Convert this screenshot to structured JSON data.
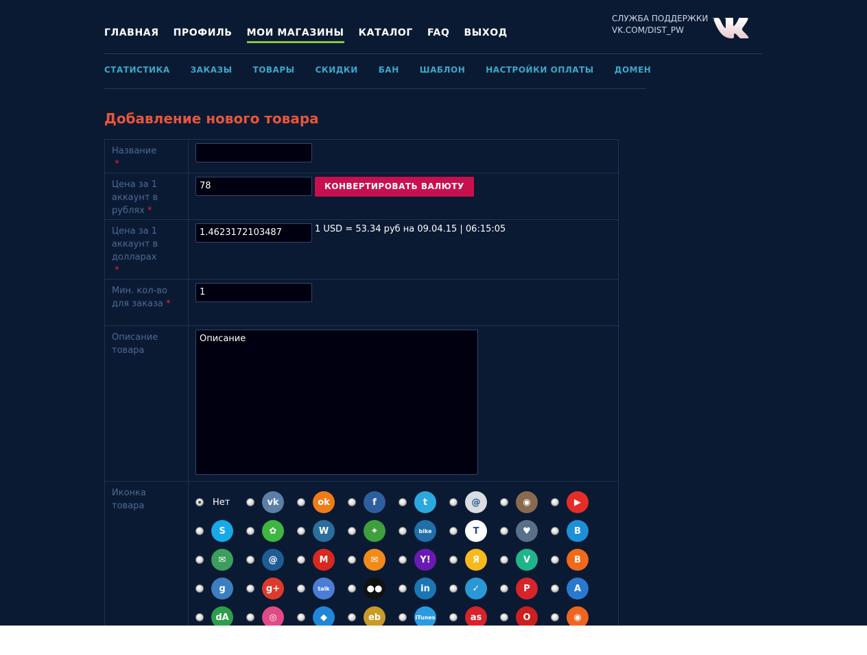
{
  "nav": {
    "items": [
      {
        "label": "ГЛАВНАЯ",
        "active": false
      },
      {
        "label": "ПРОФИЛЬ",
        "active": false
      },
      {
        "label": "МОИ МАГАЗИНЫ",
        "active": true
      },
      {
        "label": "КАТАЛОГ",
        "active": false
      },
      {
        "label": "FAQ",
        "active": false
      },
      {
        "label": "ВЫХОД",
        "active": false
      }
    ]
  },
  "support": {
    "line1": "СЛУЖБА ПОДДЕРЖКИ",
    "line2": "VK.COM/DIST_PW"
  },
  "subnav": {
    "items": [
      "СТАТИСТИКА",
      "ЗАКАЗЫ",
      "ТОВАРЫ",
      "СКИДКИ",
      "БАН",
      "ШАБЛОН",
      "НАСТРОЙКИ ОПЛАТЫ",
      "ДОМЕН"
    ]
  },
  "title": "Добавление нового товара",
  "form": {
    "name_label": "Название",
    "name_value": "",
    "price_rub_label": "Цена за 1 аккаунт в рублях",
    "price_rub_value": "78",
    "convert_button": "КОНВЕРТИРОВАТЬ ВАЛЮТУ",
    "price_usd_label": "Цена за 1 аккаунт в долларах",
    "price_usd_value": "1.4623172103487",
    "rate_text": "1 USD = 53.34 руб на 09.04.15 | 06:15:05",
    "min_qty_label": "Мин. кол-во для заказа",
    "min_qty_value": "1",
    "desc_label": "Описание товара",
    "desc_value": "Описание",
    "icon_label": "Иконка товара",
    "icon_none": "Нет",
    "required_mark": "*"
  },
  "icons": [
    {
      "name": "none",
      "checked": true
    },
    {
      "name": "vk-icon",
      "bg": "#5b7fa6",
      "glyph": "vk"
    },
    {
      "name": "odnoklassniki-icon",
      "bg": "#f07c16",
      "glyph": "ok"
    },
    {
      "name": "facebook-icon",
      "bg": "#2d5e9e",
      "glyph": "f"
    },
    {
      "name": "twitter-icon",
      "bg": "#2aa9e0",
      "glyph": "t"
    },
    {
      "name": "paperclip-icon",
      "bg": "#d9dde2",
      "glyph": "@"
    },
    {
      "name": "instagram-icon",
      "bg": "#8a6a4e",
      "glyph": "◉"
    },
    {
      "name": "youtube-icon",
      "bg": "#e52d27",
      "glyph": "▶"
    },
    {
      "name": "skype-icon",
      "bg": "#17a9e8",
      "glyph": "S"
    },
    {
      "name": "icq-icon",
      "bg": "#3fb63f",
      "glyph": "✿"
    },
    {
      "name": "warface-icon",
      "bg": "#2a6e9e",
      "glyph": "W"
    },
    {
      "name": "tanks-icon",
      "bg": "#3da03d",
      "glyph": "✦"
    },
    {
      "name": "bike-icon",
      "bg": "#1f6fa8",
      "glyph": "bike"
    },
    {
      "name": "turbo-icon",
      "bg": "#ffffff",
      "glyph": "T"
    },
    {
      "name": "heart-icon",
      "bg": "#5a6f88",
      "glyph": "♥"
    },
    {
      "name": "b-icon",
      "bg": "#1d8fd8",
      "glyph": "B"
    },
    {
      "name": "mail-icon",
      "bg": "#3c9e5c",
      "glyph": "✉"
    },
    {
      "name": "mailru-icon",
      "bg": "#1f5c94",
      "glyph": "@"
    },
    {
      "name": "gmail-icon",
      "bg": "#d8281f",
      "glyph": "M"
    },
    {
      "name": "email-icon",
      "bg": "#f28a1a",
      "glyph": "✉"
    },
    {
      "name": "yahoo-icon",
      "bg": "#6a1ab3",
      "glyph": "Y!"
    },
    {
      "name": "yandex-icon",
      "bg": "#f7b91c",
      "glyph": "Я"
    },
    {
      "name": "vine-icon",
      "bg": "#1fb58a",
      "glyph": "V"
    },
    {
      "name": "blogger-icon",
      "bg": "#f06a1a",
      "glyph": "B"
    },
    {
      "name": "google-icon",
      "bg": "#3c7ec0",
      "glyph": "g"
    },
    {
      "name": "google-plus-icon",
      "bg": "#dc3b2c",
      "glyph": "g+"
    },
    {
      "name": "talk-icon",
      "bg": "#4a7dd6",
      "glyph": "talk"
    },
    {
      "name": "myspace-icon",
      "bg": "#111111",
      "glyph": "●●"
    },
    {
      "name": "linkedin-icon",
      "bg": "#1b77b3",
      "glyph": "in"
    },
    {
      "name": "foursquare-icon",
      "bg": "#2a98d4",
      "glyph": "✓"
    },
    {
      "name": "pinterest-icon",
      "bg": "#d8232a",
      "glyph": "P"
    },
    {
      "name": "appstore-icon",
      "bg": "#2a79d0",
      "glyph": "A"
    },
    {
      "name": "deviantart-icon",
      "bg": "#2c9e4b",
      "glyph": "dA"
    },
    {
      "name": "dribbble-icon",
      "bg": "#e04a85",
      "glyph": "◎"
    },
    {
      "name": "dropbox-icon",
      "bg": "#1f86d8",
      "glyph": "◆"
    },
    {
      "name": "ebay-icon",
      "bg": "#c99a25",
      "glyph": "eb"
    },
    {
      "name": "itunes-icon",
      "bg": "#2a9be0",
      "glyph": "iTunes"
    },
    {
      "name": "lastfm-icon",
      "bg": "#d8232a",
      "glyph": "as"
    },
    {
      "name": "opera-icon",
      "bg": "#cc1f1f",
      "glyph": "O"
    },
    {
      "name": "origin-icon",
      "bg": "#f0641f",
      "glyph": "◉"
    }
  ]
}
